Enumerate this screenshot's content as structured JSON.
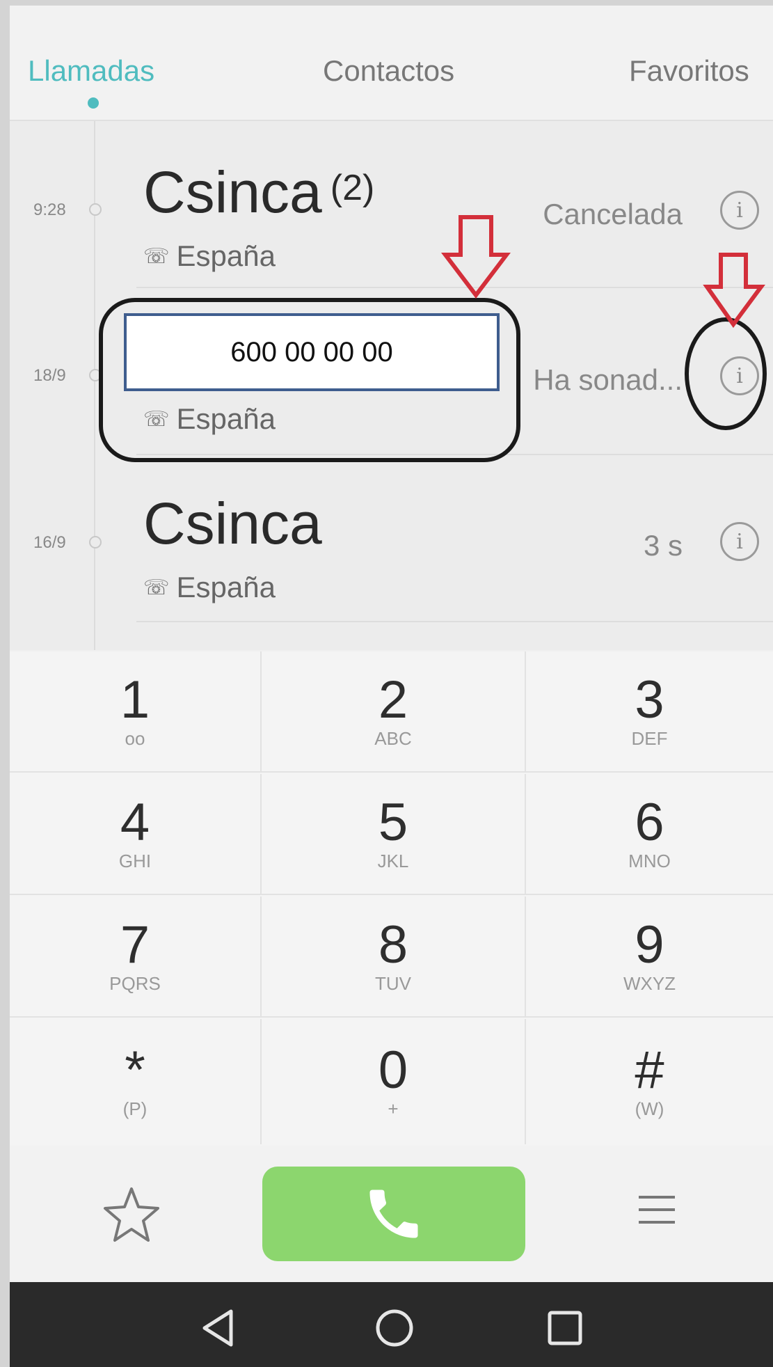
{
  "tabs": [
    {
      "label": "Llamadas",
      "active": true
    },
    {
      "label": "Contactos",
      "active": false
    },
    {
      "label": "Favoritos",
      "active": false
    }
  ],
  "calls": [
    {
      "time": "9:28",
      "name": "Csinca",
      "count": "(2)",
      "location": "España",
      "status": "Cancelada",
      "icon": "outgoing-call-icon"
    },
    {
      "time": "18/9",
      "name": "600 00 00 00",
      "location": "España",
      "status": "Ha sonad...",
      "icon": "missed-call-icon"
    },
    {
      "time": "16/9",
      "name": "Csinca",
      "location": "España",
      "status": "3 s",
      "icon": "outgoing-call-icon"
    }
  ],
  "keypad": [
    {
      "digit": "1",
      "letters": "ᴏᴏ"
    },
    {
      "digit": "2",
      "letters": "ABC"
    },
    {
      "digit": "3",
      "letters": "DEF"
    },
    {
      "digit": "4",
      "letters": "GHI"
    },
    {
      "digit": "5",
      "letters": "JKL"
    },
    {
      "digit": "6",
      "letters": "MNO"
    },
    {
      "digit": "7",
      "letters": "PQRS"
    },
    {
      "digit": "8",
      "letters": "TUV"
    },
    {
      "digit": "9",
      "letters": "WXYZ"
    },
    {
      "digit": "*",
      "letters": "(P)"
    },
    {
      "digit": "0",
      "letters": "+"
    },
    {
      "digit": "#",
      "letters": "(W)"
    }
  ],
  "info_glyph": "i",
  "colors": {
    "accent": "#4fbcbf",
    "call_button": "#8cd66e",
    "annotation_arrow": "#d32f3a"
  }
}
